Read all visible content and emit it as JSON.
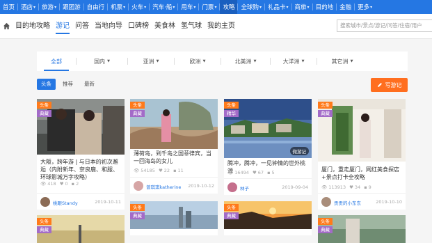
{
  "topnav": {
    "items": [
      {
        "label": "首页",
        "caret": false
      },
      {
        "label": "酒店",
        "caret": true
      },
      {
        "label": "旅游",
        "caret": true
      },
      {
        "label": "跟团游",
        "caret": false
      },
      {
        "label": "自由行",
        "caret": false
      },
      {
        "label": "机票",
        "caret": true
      },
      {
        "label": "火车",
        "caret": true
      },
      {
        "label": "汽车·船",
        "caret": true
      },
      {
        "label": "用车",
        "caret": true
      },
      {
        "label": "门票",
        "caret": true
      },
      {
        "label": "攻略",
        "caret": false,
        "active": true
      },
      {
        "label": "全球购",
        "caret": true
      },
      {
        "label": "礼品卡",
        "caret": true
      },
      {
        "label": "商旅",
        "caret": true
      },
      {
        "label": "目的地",
        "caret": false
      },
      {
        "label": "金融",
        "caret": false
      },
      {
        "label": "更多",
        "caret": true
      }
    ],
    "bg_color": "#2577e3"
  },
  "subnav": {
    "links": [
      "目的地攻略",
      "游记",
      "问答",
      "当地向导",
      "口碑榜",
      "美食林",
      "氢气球",
      "我的主页"
    ],
    "active_index": 1,
    "search_placeholder": "搜索城市/景点/游记/问答/住宿/用户"
  },
  "filter": {
    "items": [
      "全部",
      "国内",
      "亚洲",
      "欧洲",
      "北美洲",
      "大洋洲",
      "其它洲"
    ],
    "has_dropdown": [
      false,
      true,
      true,
      true,
      true,
      true,
      true
    ],
    "active_index": 0
  },
  "sort_tabs": {
    "items": [
      "头条",
      "推荐",
      "最新"
    ],
    "active_index": 0
  },
  "write_button": {
    "label": "写游记",
    "color": "#ff6e1f"
  },
  "cards": [
    {
      "badges": [
        "头条",
        "典藏"
      ],
      "title": "大阪，跨年游 | 与日本的初次邂逅（内附新年、奈良鹿、和服、环球影城万字攻略）",
      "views": "418",
      "likes": "0",
      "comments": "2",
      "user": "桃眼Standy",
      "date": "2019-10-11"
    },
    {
      "badges": [
        "头条",
        "典藏"
      ],
      "title": "薄荷岛，到千岛之国菲律宾，当一回海岛的女儿",
      "views": "54185",
      "likes": "22",
      "comments": "11",
      "user": "曾琪琪katherine",
      "date": "2019-10-12"
    },
    {
      "badges": [
        "头条",
        "精华"
      ],
      "title": "腾冲，腾冲，一见钟情的世外桃源",
      "views": "16494",
      "likes": "67",
      "comments": "5",
      "user": "林子",
      "date": "2019-09-04",
      "watermark": "微游记"
    },
    {
      "badges": [
        "头条",
        "典藏"
      ],
      "title": "厦门，重走厦门，网红美食探店+景点打卡全攻略",
      "views": "113913",
      "likes": "34",
      "comments": "9",
      "user": "贡贡的小东东",
      "date": "2019-10-10"
    },
    {
      "badges": [
        "头条",
        "典藏"
      ]
    },
    {
      "badges": [
        "头条",
        "典藏"
      ]
    },
    {
      "badges": [
        "头条",
        "典藏"
      ]
    },
    {
      "badges": [
        "头条",
        "典藏"
      ]
    }
  ]
}
